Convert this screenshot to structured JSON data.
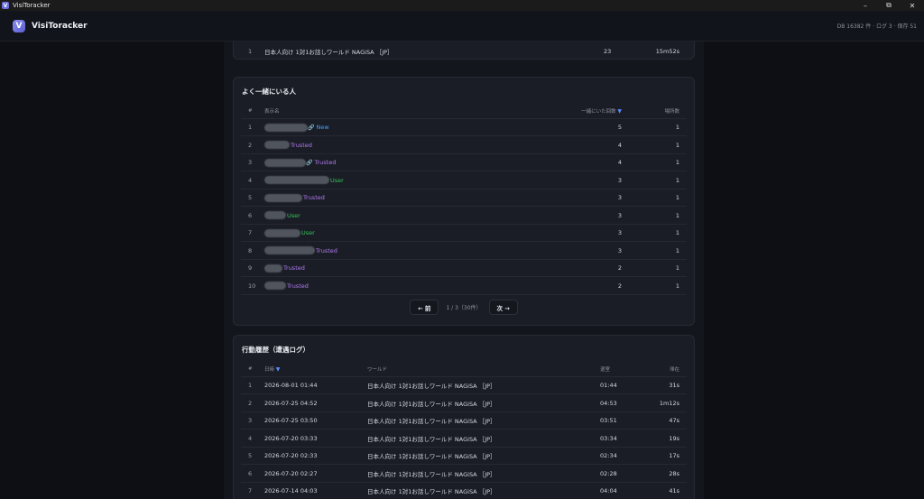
{
  "os": {
    "title": "VisiToracker",
    "app_icon_letter": "V",
    "minimize": "–",
    "maximize": "⧉",
    "close": "✕"
  },
  "app": {
    "logo_letter": "V",
    "name": "VisiToracker",
    "status": "DB 16382 件 · ログ 3 · 保存 51"
  },
  "top_world_row": {
    "index": "1",
    "world": "日本人向け 1対1お話しワールド NAGiSA ［JP］",
    "count": "23",
    "duration": "15m52s"
  },
  "companions": {
    "title": "よく一緒にいる人",
    "headers": {
      "index": "#",
      "name": "表示名",
      "together": "一緒にいた回数",
      "sort_icon": "▼",
      "places": "場所数"
    },
    "rows": [
      {
        "index": "1",
        "tag": "New",
        "tag_type": "new",
        "icon": "link-icon",
        "together": "5",
        "places": "1"
      },
      {
        "index": "2",
        "tag": "Trusted",
        "tag_type": "trusted",
        "icon": "",
        "together": "4",
        "places": "1"
      },
      {
        "index": "3",
        "tag": "Trusted",
        "tag_type": "trusted",
        "icon": "link-icon",
        "together": "4",
        "places": "1"
      },
      {
        "index": "4",
        "tag": "User",
        "tag_type": "user",
        "icon": "",
        "together": "3",
        "places": "1"
      },
      {
        "index": "5",
        "tag": "Trusted",
        "tag_type": "trusted",
        "icon": "",
        "together": "3",
        "places": "1"
      },
      {
        "index": "6",
        "tag": "User",
        "tag_type": "user",
        "icon": "",
        "together": "3",
        "places": "1"
      },
      {
        "index": "7",
        "tag": "User",
        "tag_type": "user",
        "icon": "",
        "together": "3",
        "places": "1"
      },
      {
        "index": "8",
        "tag": "Trusted",
        "tag_type": "trusted",
        "icon": "",
        "together": "3",
        "places": "1"
      },
      {
        "index": "9",
        "tag": "Trusted",
        "tag_type": "trusted",
        "icon": "",
        "together": "2",
        "places": "1"
      },
      {
        "index": "10",
        "tag": "Trusted",
        "tag_type": "trusted",
        "icon": "",
        "together": "2",
        "places": "1"
      }
    ],
    "pager": {
      "prev": "← 前",
      "info": "1 / 3（30件）",
      "next": "次 →"
    }
  },
  "history": {
    "title": "行動履歴（遭遇ログ）",
    "headers": {
      "index": "#",
      "datetime": "日時",
      "sort_icon": "▼",
      "world": "ワールド",
      "exit": "退室",
      "stay": "滞在"
    },
    "rows": [
      {
        "index": "1",
        "datetime": "2026-08-01 01:44",
        "world": "日本人向け 1対1お話しワールド NAGiSA ［JP］",
        "exit": "01:44",
        "stay": "31s"
      },
      {
        "index": "2",
        "datetime": "2026-07-25 04:52",
        "world": "日本人向け 1対1お話しワールド NAGiSA ［JP］",
        "exit": "04:53",
        "stay": "1m12s"
      },
      {
        "index": "3",
        "datetime": "2026-07-25 03:50",
        "world": "日本人向け 1対1お話しワールド NAGiSA ［JP］",
        "exit": "03:51",
        "stay": "47s"
      },
      {
        "index": "4",
        "datetime": "2026-07-20 03:33",
        "world": "日本人向け 1対1お話しワールド NAGiSA ［JP］",
        "exit": "03:34",
        "stay": "19s"
      },
      {
        "index": "5",
        "datetime": "2026-07-20 02:33",
        "world": "日本人向け 1対1お話しワールド NAGiSA ［JP］",
        "exit": "02:34",
        "stay": "17s"
      },
      {
        "index": "6",
        "datetime": "2026-07-20 02:27",
        "world": "日本人向け 1対1お話しワールド NAGiSA ［JP］",
        "exit": "02:28",
        "stay": "28s"
      },
      {
        "index": "7",
        "datetime": "2026-07-14 04:03",
        "world": "日本人向け 1対1お話しワールド NAGiSA ［JP］",
        "exit": "04:04",
        "stay": "41s"
      }
    ]
  }
}
